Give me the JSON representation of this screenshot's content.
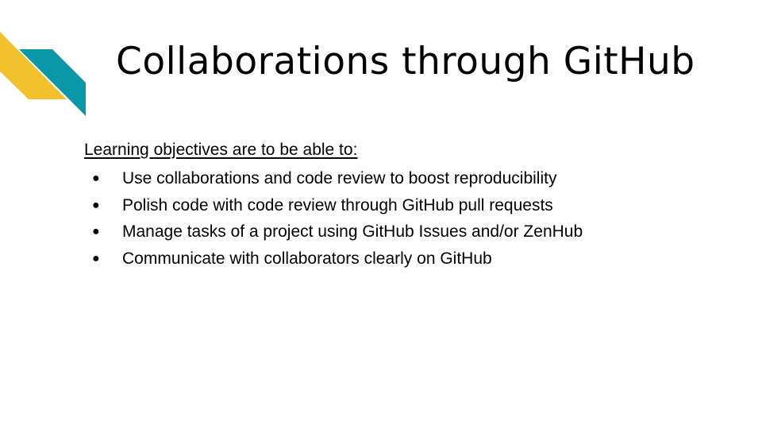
{
  "slide": {
    "title": "Collaborations through GitHub",
    "decoration": {
      "yellow": "#F2C12E",
      "teal": "#0A97A8"
    },
    "objectives": {
      "heading": "Learning objectives are to be able to:",
      "bullet_glyph": "●",
      "items": [
        "Use collaborations and code review to boost reproducibility",
        "Polish code with code review through GitHub pull requests",
        "Manage tasks of a project using GitHub Issues and/or ZenHub",
        "Communicate with collaborators clearly on GitHub"
      ]
    }
  }
}
